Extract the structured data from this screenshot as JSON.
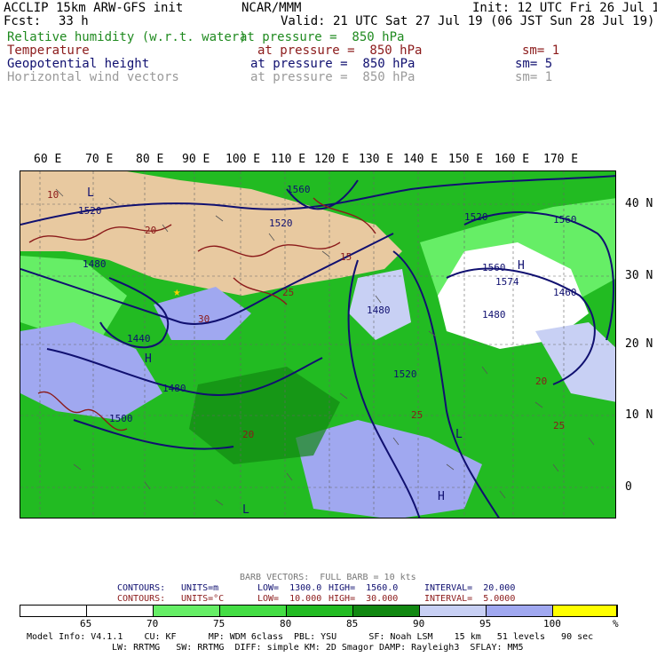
{
  "header": {
    "model": "ACCLIP 15km ARW-GFS init",
    "org": "NCAR/MMM",
    "init": "Init: 12 UTC Fri 26 Jul 19",
    "fcst_label": "Fcst:",
    "fcst_value": "33 h",
    "valid": "Valid: 21 UTC Sat 27 Jul 19 (06 JST Sun 28 Jul 19)"
  },
  "fields": [
    {
      "name": "Relative humidity (w.r.t. water)",
      "level": "at pressure =  850 hPa",
      "sm": ""
    },
    {
      "name": "Temperature",
      "level": "at pressure =  850 hPa",
      "sm": "sm= 1"
    },
    {
      "name": "Geopotential height",
      "level": "at pressure =  850 hPa",
      "sm": "sm= 5"
    },
    {
      "name": "Horizontal wind vectors",
      "level": "at pressure =  850 hPa",
      "sm": "sm= 1"
    }
  ],
  "field_colors": [
    "#1f8a1f",
    "#8b1a1a",
    "#101070",
    "#9a9a9a"
  ],
  "lon_labels": [
    "60 E",
    "70 E",
    "80 E",
    "90 E",
    "100 E",
    "110 E",
    "120 E",
    "130 E",
    "140 E",
    "150 E",
    "160 E",
    "170 E"
  ],
  "lat_labels": [
    "40 N",
    "30 N",
    "20 N",
    "10 N",
    "0"
  ],
  "map_labels": {
    "height": [
      "1520",
      "1480",
      "1520",
      "1560",
      "1440",
      "1480",
      "1500",
      "1560",
      "1480",
      "1520",
      "1560",
      "1480",
      "1520",
      "1574",
      "1460"
    ],
    "temp": [
      "20",
      "25",
      "15",
      "10",
      "30",
      "25",
      "20",
      "20",
      "25"
    ],
    "pressure_centers": [
      "H",
      "L",
      "H",
      "L",
      "H",
      "L"
    ]
  },
  "barb_info": "BARB VECTORS:  FULL BARB = 10 kts",
  "contours": [
    {
      "label": "CONTOURS:",
      "units": "UNITS=m",
      "low": "LOW=  1300.0",
      "high": "HIGH=  1560.0",
      "interval": "INTERVAL=  20.000"
    },
    {
      "label": "CONTOURS:",
      "units": "UNITS=°C",
      "low": "LOW=  10.000",
      "high": "HIGH=  30.000",
      "interval": "INTERVAL=  5.0000"
    }
  ],
  "colorbar": {
    "ticks": [
      "65",
      "70",
      "75",
      "80",
      "85",
      "90",
      "95",
      "100",
      "%"
    ],
    "colors": [
      "#ffffff",
      "#ffffff",
      "#66ee66",
      "#44dd44",
      "#22bb22",
      "#11aa11",
      "#118811",
      "#c8d0f4",
      "#a0a8f0",
      "#ffff00"
    ]
  },
  "footer": {
    "line1": "Model Info: V4.1.1    CU: KF      MP: WDM 6class  PBL: YSU      SF: Noah LSM    15 km   51 levels   90 sec",
    "line2": "LW: RRTMG   SW: RRTMG  DIFF: simple KM: 2D Smagor DAMP: Rayleigh3  SFLAY: MM5"
  }
}
